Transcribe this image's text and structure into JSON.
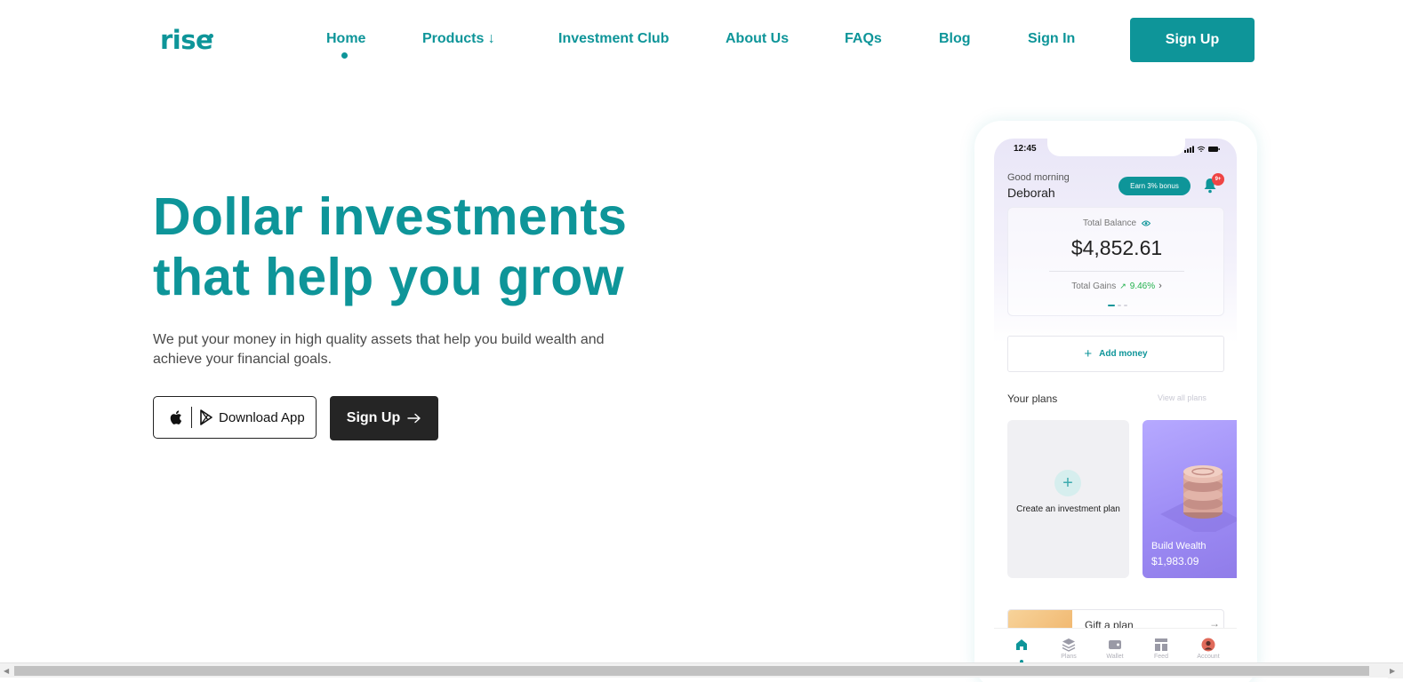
{
  "brand": {
    "logo_text": "rise",
    "accent_color": "#0e9599"
  },
  "nav": {
    "items": [
      {
        "label": "Home",
        "active": true
      },
      {
        "label": "Products ↓"
      },
      {
        "label": "Investment Club"
      },
      {
        "label": "About Us"
      },
      {
        "label": "FAQs"
      },
      {
        "label": "Blog"
      },
      {
        "label": "Sign In"
      }
    ],
    "cta_label": "Sign Up"
  },
  "hero": {
    "title_line1": "Dollar investments",
    "title_line2": "that help you grow",
    "subtitle": "We put your money in high quality assets that help you build wealth and achieve your financial goals.",
    "download_label": "Download App",
    "signup_label": "Sign Up",
    "signup_icon": "arrow-right-icon"
  },
  "phone": {
    "status_time": "12:45",
    "greeting": "Good morning",
    "user_name": "Deborah",
    "bonus_label": "Earn 3% bonus",
    "notification_badge": "9+",
    "balance_label": "Total Balance",
    "balance_value": "$4,852.61",
    "gains_label": "Total Gains",
    "gains_value": "9.46%",
    "add_money_label": "Add money",
    "plans_title": "Your plans",
    "view_all_label": "View all plans",
    "create_plan_label": "Create an investment plan",
    "plan": {
      "name": "Build Wealth",
      "amount": "$1,983.09"
    },
    "gift_label": "Gift a plan",
    "tabs": [
      {
        "label": "Home",
        "icon": "home-icon",
        "active": true
      },
      {
        "label": "Plans",
        "icon": "layers-icon"
      },
      {
        "label": "Wallet",
        "icon": "wallet-icon"
      },
      {
        "label": "Feed",
        "icon": "feed-icon"
      },
      {
        "label": "Account",
        "icon": "avatar-icon"
      }
    ]
  }
}
